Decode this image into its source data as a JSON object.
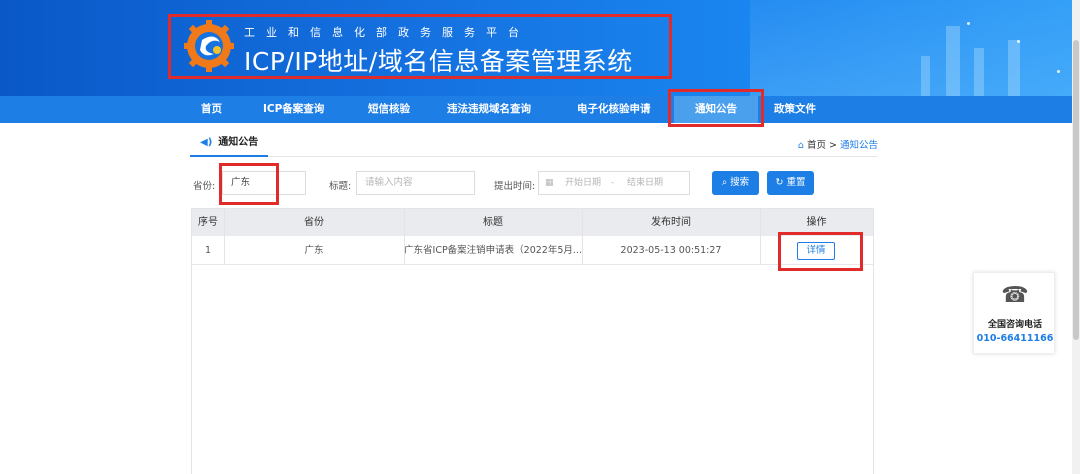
{
  "header": {
    "subtitle": "工业和信息化部政务服务平台",
    "title": "ICP/IP地址/域名信息备案管理系统"
  },
  "nav": {
    "items": [
      {
        "label": "首页"
      },
      {
        "label": "ICP备案查询"
      },
      {
        "label": "短信核验"
      },
      {
        "label": "违法违规域名查询"
      },
      {
        "label": "电子化核验申请"
      },
      {
        "label": "通知公告",
        "active": true
      },
      {
        "label": "政策文件"
      }
    ]
  },
  "section": {
    "tab": "通知公告",
    "breadcrumb_home": "首页",
    "breadcrumb_sep": ">",
    "breadcrumb_current": "通知公告"
  },
  "filters": {
    "province_label": "省份:",
    "province_value": "广东",
    "title_label": "标题:",
    "title_placeholder": "请输入内容",
    "time_label": "提出时间:",
    "start_placeholder": "开始日期",
    "date_sep": "-",
    "end_placeholder": "结束日期",
    "search_label": "搜索",
    "reset_label": "重置"
  },
  "table": {
    "columns": [
      "序号",
      "省份",
      "标题",
      "发布时间",
      "操作"
    ],
    "rows": [
      {
        "index": "1",
        "province": "广东",
        "title": "广东省ICP备案注销申请表（2022年5月...",
        "time": "2023-05-13 00:51:27",
        "action": "详情"
      }
    ]
  },
  "hotline": {
    "label": "全国咨询电话",
    "number": "010-66411166"
  },
  "colors": {
    "accent": "#1d7ee6",
    "highlight": "#e12b2b"
  }
}
